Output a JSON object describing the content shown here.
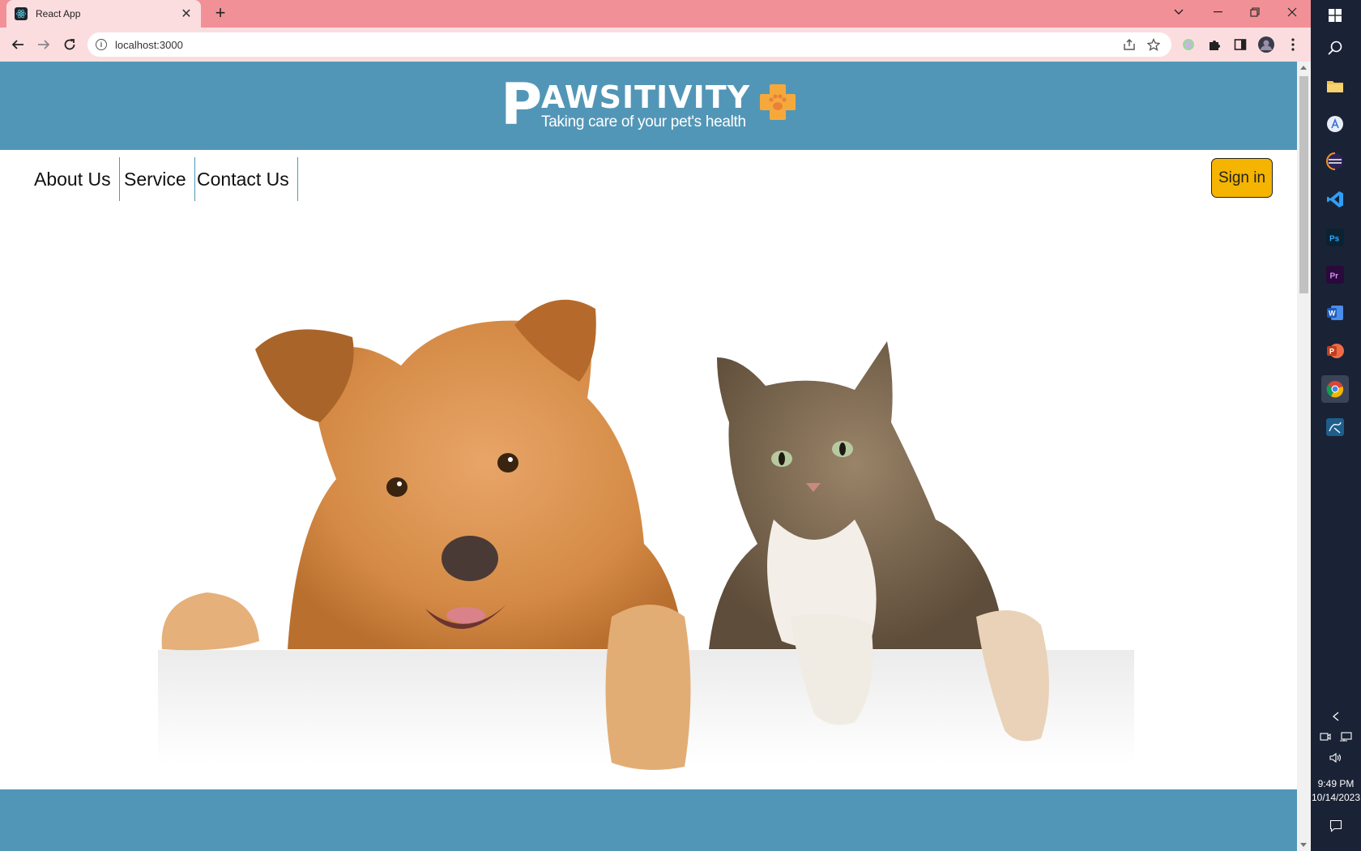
{
  "browser": {
    "tab_title": "React App",
    "url": "localhost:3000"
  },
  "site": {
    "brand_initial": "P",
    "brand_rest": "AWSITIVITY",
    "tagline": "Taking care of your pet's health",
    "nav": [
      {
        "label": "About Us"
      },
      {
        "label": "Service"
      },
      {
        "label": "Contact Us"
      }
    ],
    "signin_label": "Sign in",
    "hero_image": "dog-and-cat-photo",
    "colors": {
      "header": "#5296b7",
      "button": "#f4b400",
      "logo_cross": "#f6a93b"
    }
  },
  "taskbar": {
    "apps": [
      "windows-icon",
      "search-icon",
      "file-explorer-icon",
      "app-store-icon",
      "eclipse-icon",
      "vscode-icon",
      "photoshop-icon",
      "premiere-icon",
      "word-icon",
      "powerpoint-icon",
      "chrome-icon",
      "mysql-workbench-icon"
    ],
    "time": "9:49 PM",
    "date": "10/14/2023"
  }
}
